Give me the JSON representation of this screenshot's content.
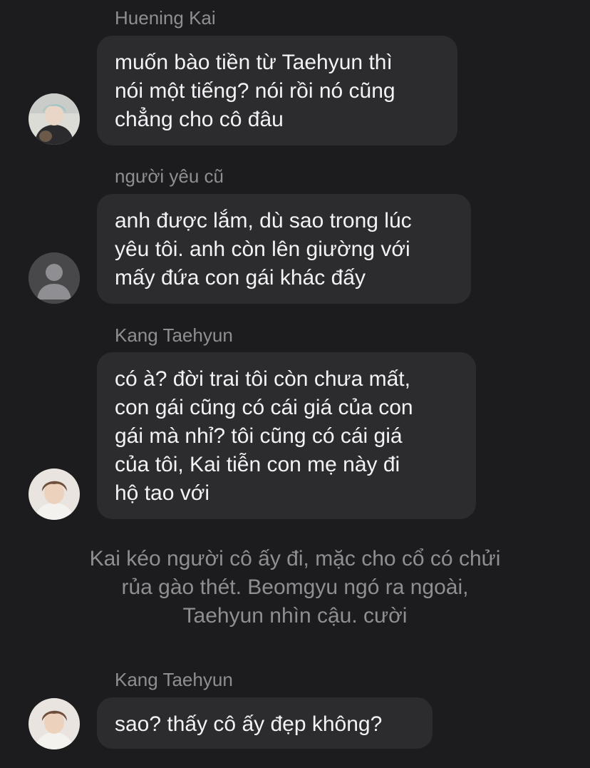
{
  "messages": [
    {
      "sender": "Huening Kai",
      "text": "muốn bào tiền từ Taehyun thì\nnói một tiếng? nói rồi nó cũng\nchẳng cho cô đâu",
      "avatar": "huening-kai-photo"
    },
    {
      "sender": "người yêu cũ",
      "text": "anh được lắm, dù sao trong lúc\nyêu tôi. anh còn lên giường với\nmấy đứa con gái khác đấy",
      "avatar": "default-person-icon"
    },
    {
      "sender": "Kang Taehyun",
      "text": "có à? đời trai tôi còn chưa mất,\ncon gái cũng có cái giá của con\ngái mà nhỉ? tôi cũng có cái giá\ncủa tôi, Kai tiễn con mẹ này đi\nhộ tao với",
      "avatar": "kang-taehyun-photo"
    },
    {
      "sender": "Kang Taehyun",
      "text": "sao? thấy cô ấy đẹp không?",
      "avatar": "kang-taehyun-photo"
    }
  ],
  "narration": "Kai kéo người cô ấy đi, mặc cho cổ có chửi\nrủa gào thét. Beomgyu ngó ra ngoài,\nTaehyun nhìn cậu. cười",
  "colors": {
    "background": "#1c1c1e",
    "bubble": "#2c2c2e",
    "text": "#f2f2f7",
    "secondary_text": "#8e8e93"
  }
}
